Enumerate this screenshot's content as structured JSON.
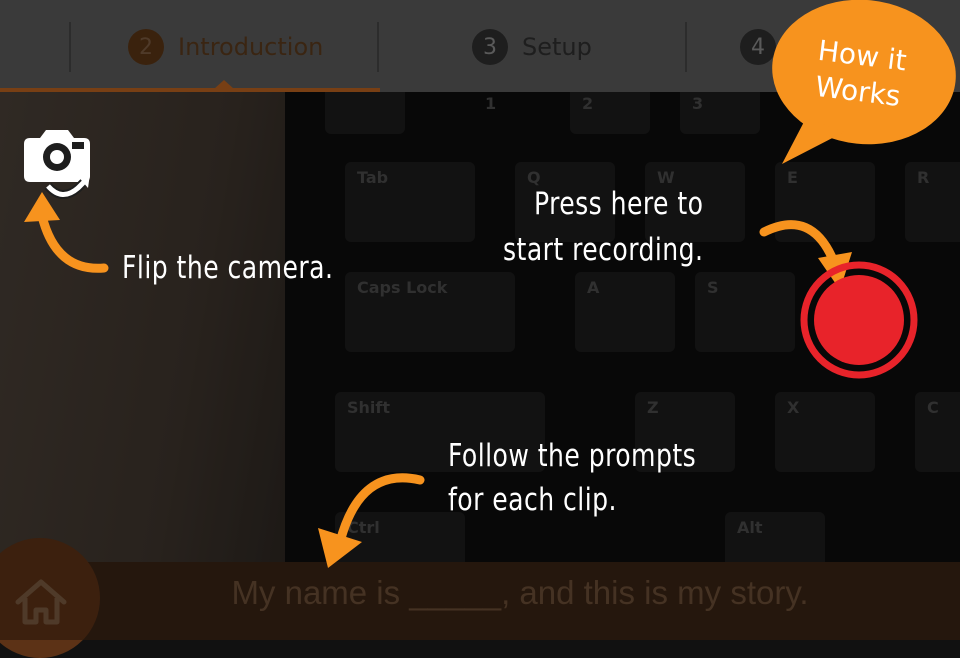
{
  "steps": [
    {
      "number": "2",
      "label": "Introduction",
      "active": true
    },
    {
      "number": "3",
      "label": "Setup",
      "active": false
    },
    {
      "number": "4",
      "label": "",
      "active": false
    }
  ],
  "help_bubble": {
    "line1": "How it",
    "line2": "Works"
  },
  "coach_marks": {
    "flip_camera": "Flip the camera.",
    "record_line1": "Press here to",
    "record_line2": "start recording.",
    "prompts_line1": "Follow the prompts",
    "prompts_line2": "for each clip."
  },
  "prompt_text": "My name is _____, and this is my story.",
  "keyboard_keys": [
    "1",
    "2",
    "3",
    "Tab",
    "Q",
    "W",
    "E",
    "R",
    "Caps Lock",
    "A",
    "S",
    "Shift",
    "Z",
    "X",
    "C",
    "Ctrl",
    "Alt"
  ],
  "icons": {
    "home": "home-icon",
    "camera_flip": "camera-flip-icon",
    "record": "record-icon"
  },
  "colors": {
    "accent_orange": "#f7931e",
    "record_red": "#e8232a",
    "coach_text": "#ffffff"
  }
}
